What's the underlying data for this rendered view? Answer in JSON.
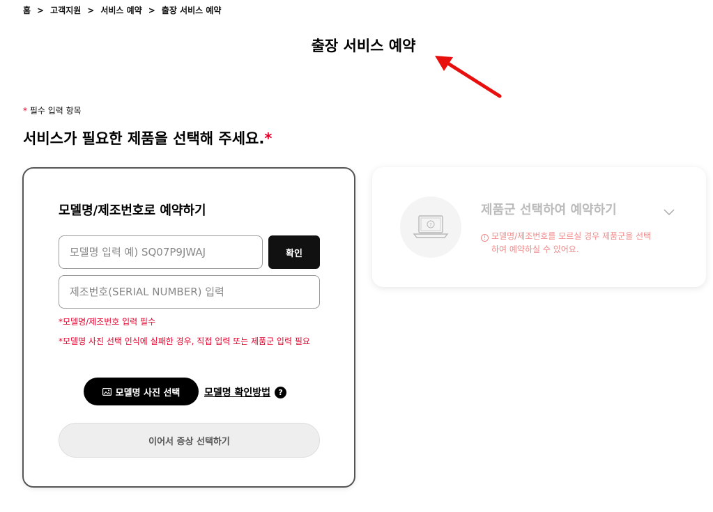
{
  "breadcrumb": {
    "items": [
      "홈",
      "고객지원",
      "서비스 예약",
      "출장 서비스 예약"
    ],
    "separator": ">"
  },
  "page_title": "출장 서비스 예약",
  "required_note": {
    "star": "*",
    "text": " 필수 입력 항목"
  },
  "section_heading": {
    "text": "서비스가 필요한 제품을 선택해 주세요.",
    "star": "*"
  },
  "model_card": {
    "title": "모델명/제조번호로 예약하기",
    "model_input": {
      "placeholder": "모델명 입력 예) SQ07P9JWAJ",
      "value": ""
    },
    "confirm_label": "확인",
    "serial_input": {
      "placeholder": "제조번호(SERIAL NUMBER) 입력",
      "value": ""
    },
    "error_required": "*모델명/제조번호 입력 필수",
    "error_photo": "*모델명 사진 선택 인식에 실패한 경우, 직접 입력 또는 제품군 입력 필요",
    "photo_button_label": "모델명 사진 선택",
    "how_to_link": "모델명 확인방법",
    "help_icon": "?",
    "continue_label": "이어서 증상 선택하기"
  },
  "category_card": {
    "title": "제품군 선택하여 예약하기",
    "info_icon": "!",
    "info_line1": "모델명/제조번호를 모르실 경우 제품군을 선택",
    "info_line2": "하여 예약하실 수 있어요.",
    "product_icon": "laptop-question-icon"
  },
  "colors": {
    "accent_red": "#e4002b",
    "button_black": "#111111",
    "muted_title": "#bbbbbb",
    "info_pink": "#f08a8a"
  }
}
